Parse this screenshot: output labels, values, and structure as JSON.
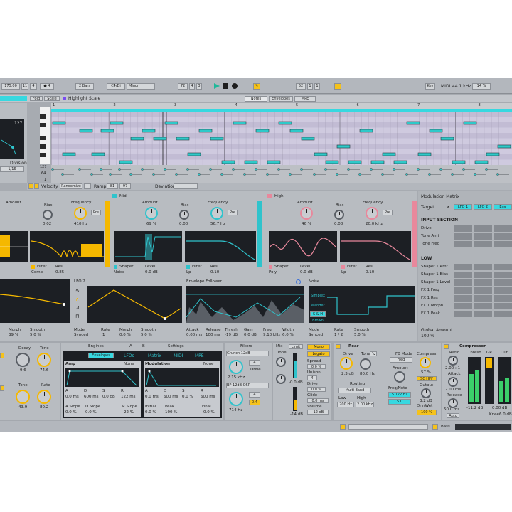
{
  "transport": {
    "tempo": "175.00",
    "sig_a": "11",
    "sig_b": "4",
    "metro": "4",
    "loop_len": "2 Bars",
    "key": "C4/Di",
    "scale": "Minor",
    "pos_a": "72",
    "pos_b": "4",
    "pos_c": "3",
    "pos2_a": "52",
    "pos2_b": "1",
    "pos2_c": "1",
    "key_label": "Key",
    "midi_label": "MIDI",
    "sample_rate": "44.1 kHz",
    "cpu": "14 %"
  },
  "clip": {
    "fold": "Fold",
    "scale": "Scale",
    "highlight": "Highlight Scale",
    "tabs": [
      "Notes",
      "Envelopes",
      "MPE"
    ],
    "ruler": [
      "1",
      "2",
      "3",
      "4",
      "5",
      "6",
      "7",
      "8"
    ],
    "velocity_num": "127",
    "division_label": "Division",
    "division_value": "1/16",
    "vel_127": "127",
    "vel_64": "64",
    "vel_1": "1",
    "footer": {
      "velocity": "Velocity",
      "randomize": "Randomize",
      "ramp": "Ramp",
      "ramp_a": "81",
      "ramp_b": "97",
      "deviation": "Deviation"
    }
  },
  "bands": [
    {
      "name": "",
      "amount": "Amount",
      "bias": "Bias",
      "bias_val": "0.02",
      "freq": "Frequency",
      "freq_val": "410 Hz",
      "pre": "Pre",
      "filter": "Filter",
      "res": "Res",
      "filter_type": "Comb",
      "res_val": "0.85",
      "color": "#f5b800"
    },
    {
      "name": "Mid",
      "amount": "Amount",
      "amount_val": "69 %",
      "bias": "Bias",
      "bias_val": "0.00",
      "freq": "Frequency",
      "freq_val": "56.7 Hz",
      "pre": "Pre",
      "shaper": "Shaper",
      "level": "Level",
      "shaper_type": "Noise",
      "level_val": "0.0 dB",
      "filter": "Filter",
      "res": "Res",
      "filter_type": "Lp",
      "res_val": "0.10",
      "color": "#2fc3cc"
    },
    {
      "name": "High",
      "amount": "Amount",
      "amount_val": "46 %",
      "bias": "Bias",
      "bias_val": "0.08",
      "freq": "Frequency",
      "freq_val": "20.0 kHz",
      "pre": "Pre",
      "shaper": "Shaper",
      "level": "Level",
      "shaper_type": "Poly",
      "level_val": "0.0 dB",
      "filter": "Filter",
      "res": "Res",
      "filter_type": "Lp",
      "res_val": "0.10",
      "color": "#e8889c"
    }
  ],
  "modmatrix": {
    "title": "Modulation Matrix",
    "target": "Target",
    "lfo1": "LFO 1",
    "lfo2": "LFO 2",
    "env": "Env",
    "input_section": "INPUT SECTION",
    "input_rows": [
      "Drive",
      "Tone Amt",
      "Tone Freq"
    ],
    "low": "LOW",
    "low_rows": [
      "Shaper 1 Amt",
      "Shaper 1 Bias",
      "Shaper 1 Level",
      "FX 1 Freq",
      "FX 1 Res",
      "FX 1 Morph",
      "FX 1 Peak"
    ],
    "global_amount": "Global Amount",
    "global_val": "100 %"
  },
  "mods": {
    "lfo1": {
      "morph": "Morph",
      "smooth": "Smooth",
      "morph_val": "39 %",
      "smooth_val": "5.0 %"
    },
    "lfo2": {
      "title": "LFO 2",
      "mode": "Mode",
      "rate": "Rate",
      "morph": "Morph",
      "smooth": "Smooth",
      "mode_val": "Synced",
      "rate_val": "1",
      "morph_val": "0.0 %",
      "smooth_val": "5.0 %"
    },
    "env": {
      "title": "Envelope Follower",
      "attack": "Attack",
      "release": "Release",
      "thresh": "Thresh",
      "gain": "Gain",
      "freq": "Freq",
      "width": "Width",
      "attack_val": "0.00 ms",
      "release_val": "100 ms",
      "thresh_val": "-19 dB",
      "gain_val": "0.0 dB",
      "freq_val": "9.10 kHz",
      "width_val": "6.0 %"
    },
    "noise": {
      "title": "Noise",
      "simplex": "Simplex",
      "wander": "Wander",
      "sh": "S & H",
      "brown": "Brown",
      "mode": "Mode",
      "rate": "Rate",
      "smooth": "Smooth",
      "mode_val": "Synced",
      "rate_val": "1 / 2",
      "smooth_val": "5.0 %"
    }
  },
  "drum": {
    "decay": "Decay",
    "decay_val": "9.6",
    "tone": "Tone",
    "tone_val": "74.6",
    "tone2": "Tone",
    "tone2_val": "43.9",
    "rate": "Rate",
    "rate_val": "80.2"
  },
  "synth": {
    "engines": "Engines",
    "tab_a": "A",
    "tab_b": "B",
    "settings": "Settings",
    "subtabs": [
      "Envelopes",
      "LFOs",
      "Matrix",
      "MIDI",
      "MPE"
    ],
    "amp": "Amp",
    "none1": "None",
    "modulation": "Modulation",
    "none2": "None",
    "amp_labels": [
      "A",
      "D",
      "S",
      "R"
    ],
    "amp_vals": [
      "0.0 ms",
      "600 ms",
      "0.0 dB",
      "122 ms"
    ],
    "mod_labels": [
      "A",
      "D",
      "S",
      "R"
    ],
    "mod_vals": [
      "0.0 ms",
      "600 ms",
      "0.0 %",
      "600 ms"
    ],
    "aslope": "A Slope",
    "dslope": "D Slope",
    "rslope": "R Slope",
    "aslope_val": "0.0 %",
    "dslope_val": "0.0 %",
    "rslope_val": "22 %",
    "initial": "Initial",
    "peak": "Peak",
    "final": "Final",
    "initial_val": "0.0 %",
    "peak_val": "100 %",
    "final_val": "0.0 %"
  },
  "filters": {
    "title": "Filters",
    "f1": "Grunch 12dB",
    "f1_a": "4",
    "freq1": "2.15 kHz",
    "drive": "Drive",
    "f2": "BP 12dB OSR",
    "f2_a": "4",
    "freq2": "714 Hz",
    "r2": "0.4"
  },
  "mix": {
    "title": "Mix",
    "limit": "Limit",
    "tone": "Tone",
    "vol1": "-0.0 dB",
    "vol2": "-14 dB",
    "mono": "Mono",
    "legato": "Legato",
    "spread": "Spread",
    "spread_val": "0.0 %",
    "unison": "Unison",
    "unison_val": "4",
    "drive": "Drive",
    "drive_val": "0.0 %",
    "glide": "Glide",
    "glide_val": "0.0 ms",
    "volume": "Volume",
    "volume_val": "-12 dB"
  },
  "roar": {
    "title": "Roar",
    "drive": "Drive",
    "drive_val": "2.3 dB",
    "tone": "Tone",
    "tone_val": "80.0 Hz",
    "routing": "Routing",
    "routing_val": "Multi Band",
    "low": "Low",
    "high": "High",
    "low_val": "200 Hz",
    "high_val": "2.00 kHz",
    "fb_mode": "FB Mode",
    "fb_val": "Freq",
    "amount": "Amount",
    "freq_note": "Freq/Note",
    "freq_val": "5.122 Hz",
    "val3": "5.0",
    "compress": "Compress",
    "compress_val": "57 %",
    "output": "Output",
    "output_val": "3.2 dB",
    "dry_wet": "Dry/Wet",
    "dry_wet_val": "100 %",
    "sc_hpf": "SC HPF"
  },
  "comp": {
    "title": "Compressor",
    "ratio": "Ratio",
    "ratio_val": "2.00 : 1",
    "attack": "Attack",
    "attack_val": "2.00 ms",
    "release": "Release",
    "release_val": "50.0 ms",
    "auto": "Auto",
    "thresh": "Thresh",
    "gr": "GR",
    "out": "Out",
    "thresh_val": "-11.2 dB",
    "out_val": "0.00 dB",
    "knee": "Knee",
    "knee_val": "6.0 dB"
  },
  "bottom": {
    "bass": "Bass"
  },
  "colors": {
    "accent_yellow": "#f5b800",
    "accent_cyan": "#2fc3cc",
    "accent_pink": "#e8889c",
    "panel_dark": "#1c1f24",
    "note_fill": "#2ec9c9"
  }
}
